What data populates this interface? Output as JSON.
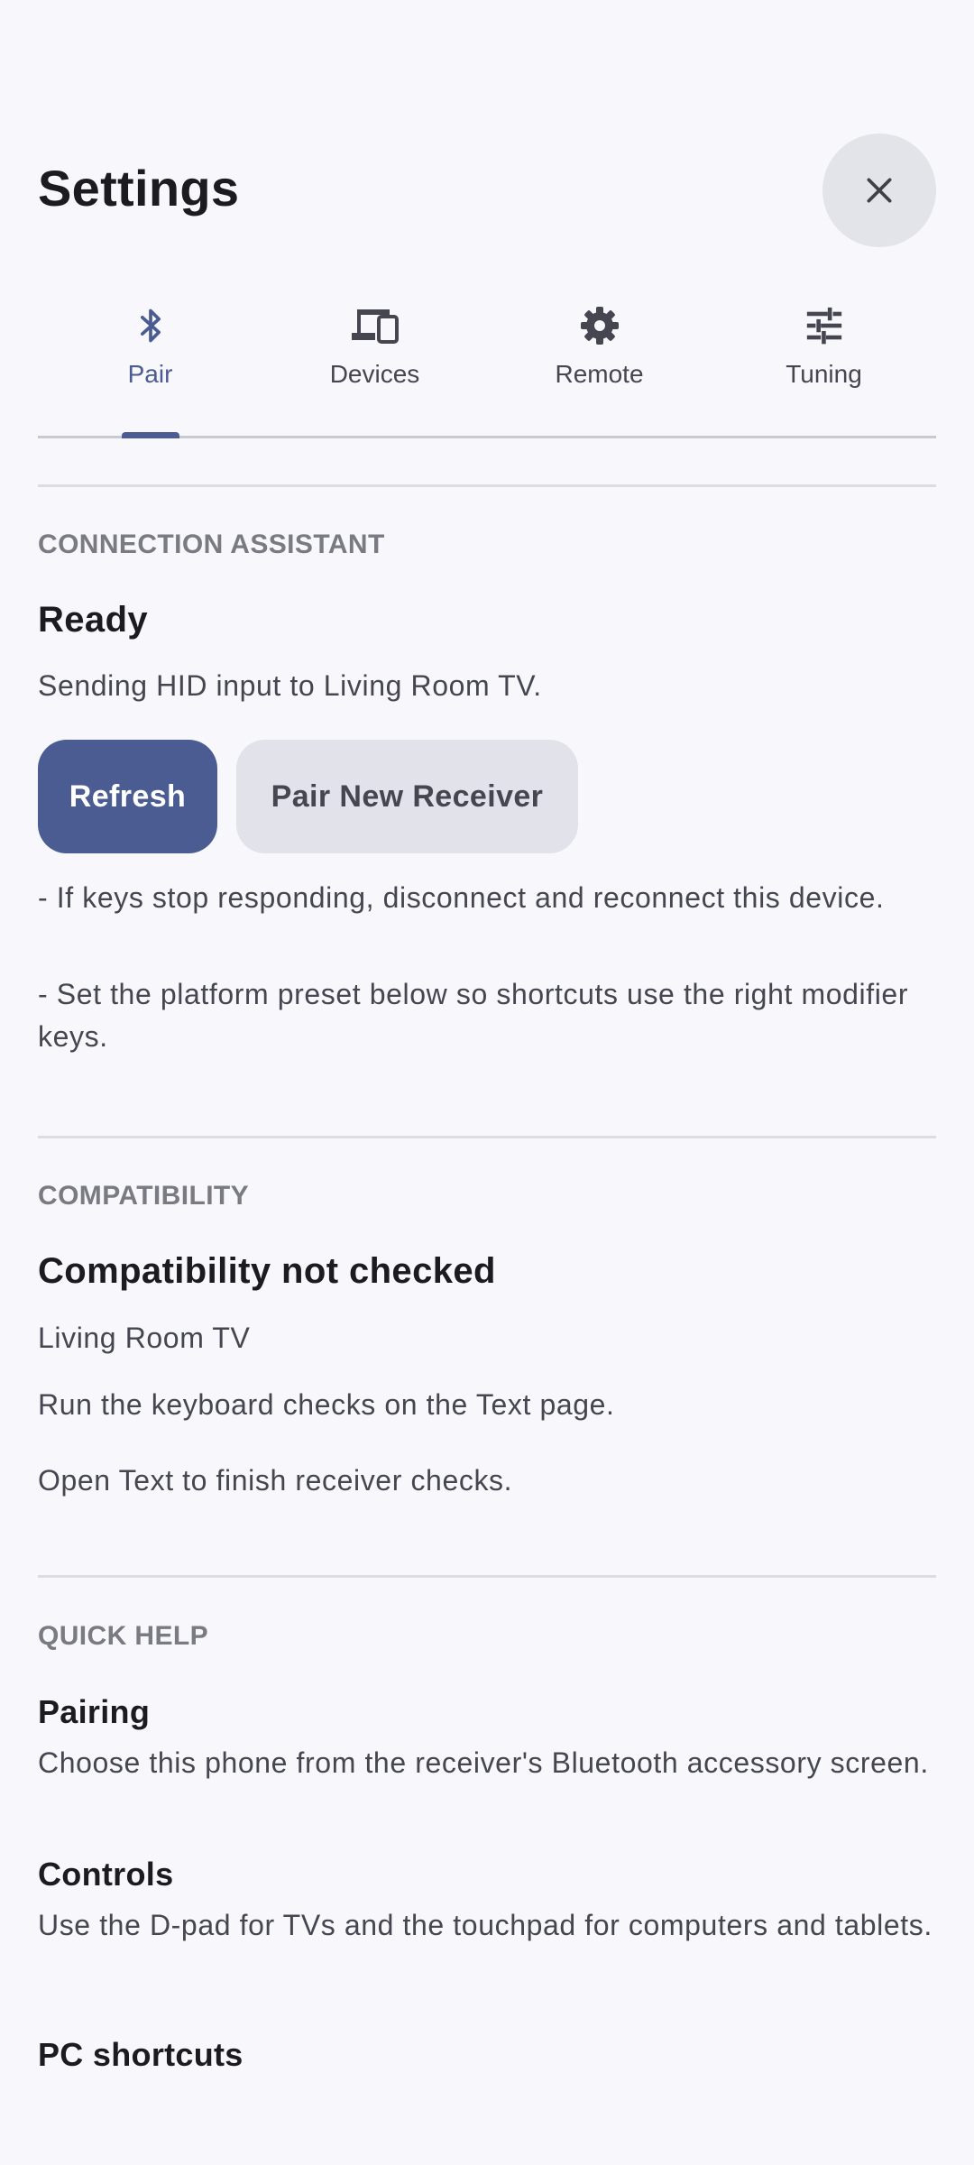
{
  "header": {
    "title": "Settings",
    "close_icon": "close-icon"
  },
  "tabs": [
    {
      "label": "Pair",
      "icon": "bluetooth-icon",
      "active": true
    },
    {
      "label": "Devices",
      "icon": "devices-icon",
      "active": false
    },
    {
      "label": "Remote",
      "icon": "gear-icon",
      "active": false
    },
    {
      "label": "Tuning",
      "icon": "tune-icon",
      "active": false
    }
  ],
  "connection": {
    "section_label": "CONNECTION ASSISTANT",
    "status": "Ready",
    "description": "Sending HID input to Living Room TV.",
    "refresh_label": "Refresh",
    "pair_label": "Pair New Receiver",
    "tips": [
      "- If keys stop responding, disconnect and reconnect this device.",
      "- Set the platform preset below so shortcuts use the right modifier keys."
    ]
  },
  "compatibility": {
    "section_label": "COMPATIBILITY",
    "status": "Compatibility not checked",
    "device": "Living Room TV",
    "instruction": "Run the keyboard checks on the Text page.",
    "note": "Open Text to finish receiver checks."
  },
  "quick_help": {
    "section_label": "QUICK HELP",
    "items": [
      {
        "title": "Pairing",
        "text": "Choose this phone from the receiver's Bluetooth accessory screen."
      },
      {
        "title": "Controls",
        "text": "Use the D-pad for TVs and the touchpad for computers and tablets."
      },
      {
        "title": "PC shortcuts"
      }
    ]
  },
  "colors": {
    "accent": "#4a5c92",
    "background": "#f7f7fc",
    "secondary_button": "#e2e2ea"
  }
}
